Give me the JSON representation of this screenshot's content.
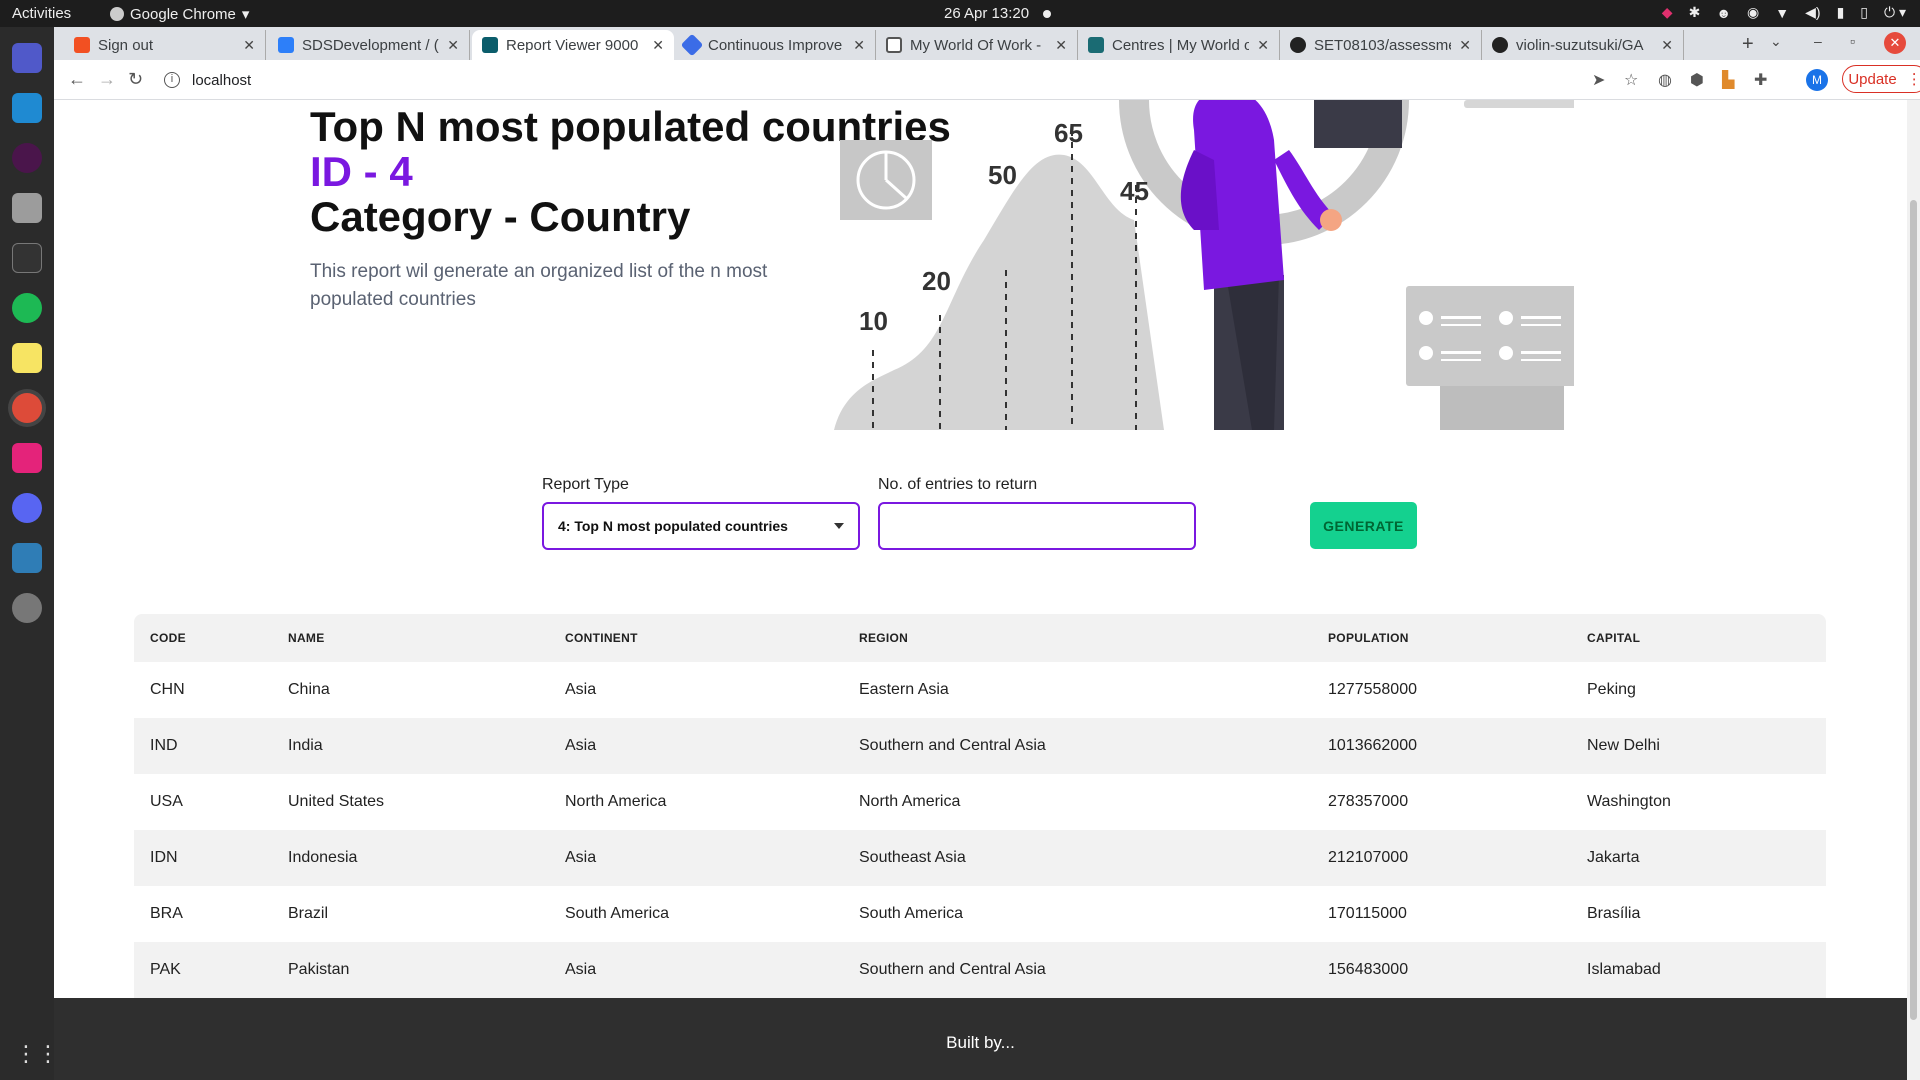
{
  "topbar": {
    "activities": "Activities",
    "app_name": "Google Chrome",
    "clock": "26 Apr  13:20"
  },
  "tabs": [
    {
      "title": "Sign out",
      "color": "#f25022"
    },
    {
      "title": "SDSDevelopment / (",
      "color": "#2d7ff9"
    },
    {
      "title": "Report Viewer 9000",
      "color": "#0b5d6b"
    },
    {
      "title": "Continuous Improve",
      "color": "#3b6ce7"
    },
    {
      "title": "My World Of Work -",
      "color": "#555555"
    },
    {
      "title": "Centres | My World o",
      "color": "#1a6b73"
    },
    {
      "title": "SET08103/assessme",
      "color": "#222222"
    },
    {
      "title": "violin-suzutsuki/GA",
      "color": "#222222"
    }
  ],
  "address": {
    "url": "localhost",
    "update_label": "Update",
    "avatar_letter": "M"
  },
  "hero": {
    "title": "Top N most populated countries",
    "id": "ID - 4",
    "category": "Category - Country",
    "description": "This report wil generate an organized list of the n most populated countries",
    "chart_labels": [
      "10",
      "20",
      "50",
      "65",
      "45"
    ]
  },
  "form": {
    "report_type_label": "Report Type",
    "report_type_value": "4: Top N most populated countries",
    "entries_label": "No. of entries to return",
    "entries_value": "",
    "generate_label": "GENERATE"
  },
  "table": {
    "headers": [
      "CODE",
      "NAME",
      "CONTINENT",
      "REGION",
      "POPULATION",
      "CAPITAL"
    ],
    "rows": [
      [
        "CHN",
        "China",
        "Asia",
        "Eastern Asia",
        "1277558000",
        "Peking"
      ],
      [
        "IND",
        "India",
        "Asia",
        "Southern and Central Asia",
        "1013662000",
        "New Delhi"
      ],
      [
        "USA",
        "United States",
        "North America",
        "North America",
        "278357000",
        "Washington"
      ],
      [
        "IDN",
        "Indonesia",
        "Asia",
        "Southeast Asia",
        "212107000",
        "Jakarta"
      ],
      [
        "BRA",
        "Brazil",
        "South America",
        "South America",
        "170115000",
        "Brasília"
      ],
      [
        "PAK",
        "Pakistan",
        "Asia",
        "Southern and Central Asia",
        "156483000",
        "Islamabad"
      ]
    ]
  },
  "footer": {
    "text": "Built by..."
  },
  "colors": {
    "accent": "#7a18e0",
    "button": "#14d18f"
  }
}
